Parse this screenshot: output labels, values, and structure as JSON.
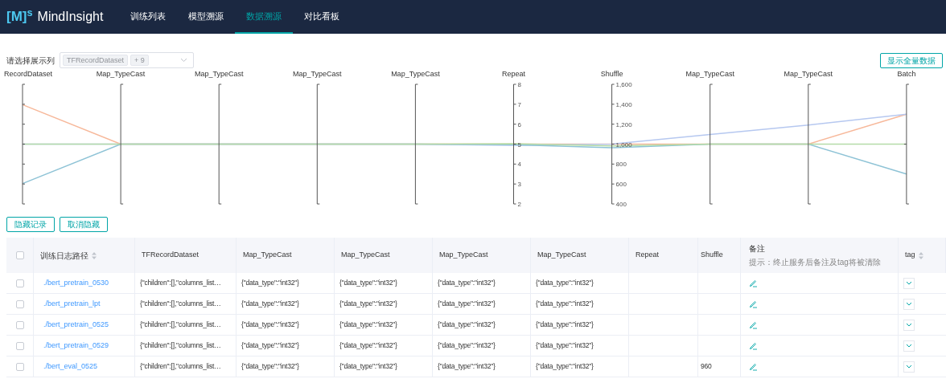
{
  "header": {
    "logo": "[M]$^{s}$",
    "brand": "MindInsight",
    "nav": [
      {
        "label": "训练列表",
        "selected": false
      },
      {
        "label": "模型溯源",
        "selected": false
      },
      {
        "label": "数据溯源",
        "selected": true
      },
      {
        "label": "对比看板",
        "selected": false
      }
    ]
  },
  "filter": {
    "label": "请选择展示列",
    "tags": [
      "TFRecordDataset",
      "+ 9"
    ]
  },
  "show_all_button": "显示全量数据",
  "axes": [
    {
      "name": "RecordDataset"
    },
    {
      "name": "Map_TypeCast"
    },
    {
      "name": "Map_TypeCast"
    },
    {
      "name": "Map_TypeCast"
    },
    {
      "name": "Map_TypeCast"
    },
    {
      "name": "Repeat",
      "ticks": [
        "8",
        "7",
        "6",
        "5",
        "4",
        "3",
        "2"
      ]
    },
    {
      "name": "Shuffle",
      "ticks": [
        "1,600",
        "1,400",
        "1,200",
        "1,000",
        "800",
        "600",
        "400"
      ]
    },
    {
      "name": "Map_TypeCast"
    },
    {
      "name": "Map_TypeCast"
    },
    {
      "name": "Batch"
    }
  ],
  "actions": [
    "隐藏记录",
    "取消隐藏"
  ],
  "table": {
    "select_all_checked": false,
    "columns": [
      {
        "label": "训练日志路径",
        "sortable": true
      },
      {
        "label": "TFRecordDataset",
        "sortable": false
      },
      {
        "label": "Map_TypeCast",
        "sortable": false
      },
      {
        "label": "Map_TypeCast",
        "sortable": false
      },
      {
        "label": "Map_TypeCast",
        "sortable": false
      },
      {
        "label": "Map_TypeCast",
        "sortable": false
      },
      {
        "label": "Repeat",
        "sortable": false
      },
      {
        "label": "Shuffle",
        "sortable": false
      },
      {
        "label": "备注",
        "hint": "提示：终止服务后备注及tag将被清除",
        "sortable": false
      },
      {
        "label": "tag",
        "sortable": true
      }
    ],
    "rows": [
      {
        "checked": false,
        "cells": [
          "./bert_pretrain_0530",
          "{\"children\":[],\"columns_list…",
          "{\"data_type\":\"int32\"}",
          "{\"data_type\":\"int32\"}",
          "{\"data_type\":\"int32\"}",
          "{\"data_type\":\"int32\"}",
          "",
          ""
        ]
      },
      {
        "checked": false,
        "cells": [
          "./bert_pretrain_lpt",
          "{\"children\":[],\"columns_list…",
          "{\"data_type\":\"int32\"}",
          "{\"data_type\":\"int32\"}",
          "{\"data_type\":\"int32\"}",
          "{\"data_type\":\"int32\"}",
          "",
          ""
        ]
      },
      {
        "checked": false,
        "cells": [
          "./bert_pretrain_0525",
          "{\"children\":[],\"columns_list…",
          "{\"data_type\":\"int32\"}",
          "{\"data_type\":\"int32\"}",
          "{\"data_type\":\"int32\"}",
          "{\"data_type\":\"int32\"}",
          "",
          ""
        ]
      },
      {
        "checked": false,
        "cells": [
          "./bert_pretrain_0529",
          "{\"children\":[],\"columns_list…",
          "{\"data_type\":\"int32\"}",
          "{\"data_type\":\"int32\"}",
          "{\"data_type\":\"int32\"}",
          "{\"data_type\":\"int32\"}",
          "",
          ""
        ]
      },
      {
        "checked": false,
        "cells": [
          "./bert_eval_0525",
          "{\"children\":[],\"columns_list…",
          "{\"data_type\":\"int32\"}",
          "{\"data_type\":\"int32\"}",
          "{\"data_type\":\"int32\"}",
          "{\"data_type\":\"int32\"}",
          "",
          "960"
        ]
      }
    ]
  }
}
